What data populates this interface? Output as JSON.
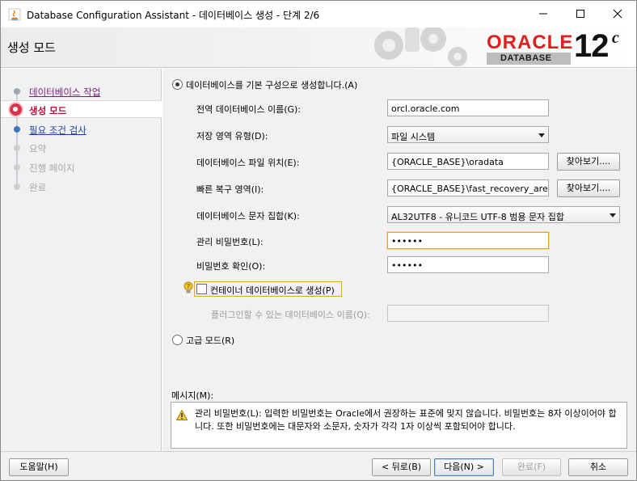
{
  "window": {
    "title": "Database Configuration Assistant - 데이터베이스 생성 - 단계 2/6",
    "minimize_icon": "minimize-icon",
    "maximize_icon": "maximize-icon",
    "close_icon": "close-icon"
  },
  "header": {
    "title": "생성 모드",
    "brand": "ORACLE",
    "product": "DATABASE",
    "version": "12",
    "version_sup": "c",
    "brand_color": "#e0201d"
  },
  "sidebar": {
    "items": [
      {
        "label": "데이터베이스 작업",
        "state": "done"
      },
      {
        "label": "생성 모드",
        "state": "current"
      },
      {
        "label": "필요 조건 검사",
        "state": "next"
      },
      {
        "label": "요약",
        "state": "disabled"
      },
      {
        "label": "진행 페이지",
        "state": "disabled"
      },
      {
        "label": "완료",
        "state": "disabled"
      }
    ]
  },
  "form": {
    "default_config_radio": "데이터베이스를 기본 구성으로 생성합니다.(A)",
    "global_db_name": {
      "label": "전역 데이터베이스 이름(G):",
      "value": "orcl.oracle.com"
    },
    "storage_type": {
      "label": "저장 영역 유형(D):",
      "value": "파일 시스템"
    },
    "db_file_location": {
      "label": "데이터베이스 파일 위치(E):",
      "value": "{ORACLE_BASE}\\oradata",
      "browse": "찾아보기...."
    },
    "fast_recovery_area": {
      "label": "빠른 복구 영역(I):",
      "value": "{ORACLE_BASE}\\fast_recovery_area",
      "browse": "찾아보기...."
    },
    "charset": {
      "label": "데이터베이스 문자 집합(K):",
      "value": "AL32UTF8 - 유니코드 UTF-8 범용 문자 집합"
    },
    "admin_password": {
      "label": "관리 비밀번호(L):",
      "value": "••••••"
    },
    "confirm_password": {
      "label": "비밀번호 확인(O):",
      "value": "••••••"
    },
    "container_db_checkbox": "컨테이너 데이터베이스로 생성(P)",
    "pluggable_db_name": {
      "label": "플러그인할 수 있는 데이터베이스 이름(Q):",
      "value": ""
    },
    "advanced_mode_radio": "고급 모드(R)"
  },
  "messages": {
    "title": "메시지(M):",
    "text": "관리 비밀번호(L): 입력한 비밀번호는 Oracle에서 권장하는 표준에 맞지 않습니다. 비밀번호는 8자 이상이어야 합니다. 또한 비밀번호에는 대문자와 소문자, 숫자가 각각 1자 이상씩 포함되어야 합니다."
  },
  "footer": {
    "help": "도움말(H)",
    "back": "< 뒤로(B)",
    "next": "다음(N) >",
    "finish": "완료(F)",
    "cancel": "취소"
  }
}
